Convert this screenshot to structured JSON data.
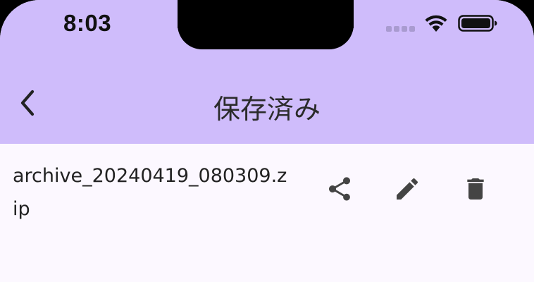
{
  "status_bar": {
    "time": "8:03",
    "icons": [
      "cellular-signal-icon",
      "wifi-icon",
      "battery-icon"
    ]
  },
  "app_bar": {
    "title": "保存済み",
    "back_icon": "chevron-left-icon",
    "background_color": "#cfbcfb"
  },
  "files": [
    {
      "name": "archive_20240419_080309.zip",
      "actions": [
        "share-icon",
        "edit-pencil-icon",
        "delete-trash-icon"
      ]
    }
  ],
  "colors": {
    "surface": "#fcf8ff",
    "icon": "#444444",
    "text": "#222222"
  }
}
